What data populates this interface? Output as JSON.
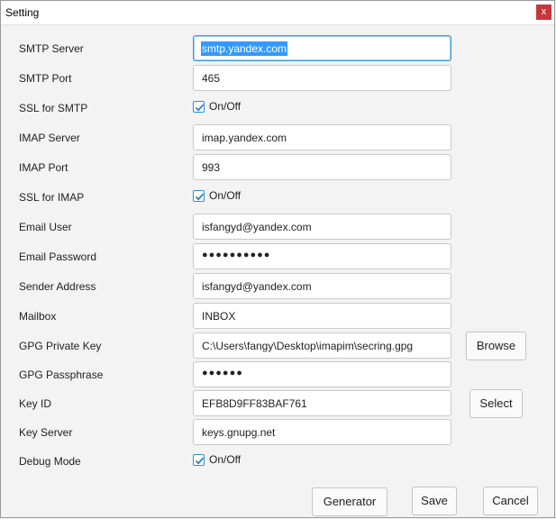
{
  "window": {
    "title": "Setting",
    "close_label": "x"
  },
  "fields": {
    "smtp_server": {
      "label": "SMTP Server",
      "value": "smtp.yandex.com"
    },
    "smtp_port": {
      "label": "SMTP Port",
      "value": "465"
    },
    "ssl_smtp": {
      "label": "SSL for SMTP",
      "checkbox_label": "On/Off",
      "checked": true
    },
    "imap_server": {
      "label": "IMAP Server",
      "value": "imap.yandex.com"
    },
    "imap_port": {
      "label": "IMAP Port",
      "value": "993"
    },
    "ssl_imap": {
      "label": "SSL for IMAP",
      "checkbox_label": "On/Off",
      "checked": true
    },
    "email_user": {
      "label": "Email User",
      "value": "isfangyd@yandex.com"
    },
    "email_password": {
      "label": "Email Password",
      "value": "●●●●●●●●●●"
    },
    "sender_address": {
      "label": "Sender Address",
      "value": "isfangyd@yandex.com"
    },
    "mailbox": {
      "label": "Mailbox",
      "value": "INBOX"
    },
    "gpg_private_key": {
      "label": "GPG Private Key",
      "value": "C:\\Users\\fangy\\Desktop\\imapim\\secring.gpg"
    },
    "gpg_passphrase": {
      "label": "GPG Passphrase",
      "value": "●●●●●●"
    },
    "key_id": {
      "label": "Key ID",
      "value": "EFB8D9FF83BAF761"
    },
    "key_server": {
      "label": "Key Server",
      "value": "keys.gnupg.net"
    },
    "debug_mode": {
      "label": "Debug Mode",
      "checkbox_label": "On/Off",
      "checked": true
    }
  },
  "buttons": {
    "browse": "Browse",
    "select": "Select",
    "generator": "Generator",
    "save": "Save",
    "cancel": "Cancel"
  }
}
